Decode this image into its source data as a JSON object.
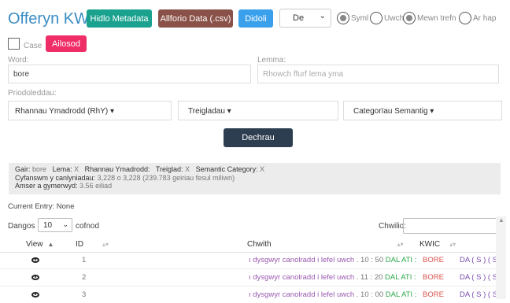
{
  "app": {
    "title": "Offeryn KWIC"
  },
  "toolbar": {
    "metadata_label": "Hidlo Metadata",
    "export_label": "Allforio Data (.csv)",
    "help_label": "Didoli",
    "select_value": "De",
    "radios": [
      {
        "label": "Syml",
        "checked": true
      },
      {
        "label": "Uwch",
        "checked": false
      },
      {
        "label": "Mewn trefn",
        "checked": true
      },
      {
        "label": "Ar hap",
        "checked": false
      }
    ]
  },
  "case_option": {
    "label": "Case",
    "button_label": "Ailosod"
  },
  "search": {
    "word_label": "Word:",
    "word_value": "bore",
    "lemma_label": "Lemma:",
    "lemma_placeholder": "Rhowch ffurf lema yma"
  },
  "attributes": {
    "label": "Priodoleddau:",
    "dropdowns": [
      "Rhannau Ymadrodd (RhY)",
      "Treigladau",
      "Categorïau Semantig"
    ]
  },
  "start_button": "Dechrau",
  "info": {
    "line1_parts": [
      "Gair:",
      "bore",
      "Lema:",
      "X",
      "Rhannau Ymadrodd:",
      "Treiglad:",
      "X",
      "Semantic Category:",
      "X"
    ],
    "totals_label": "Cyfanswm y canlyniadau:",
    "totals_value": "3,228 o 3,228 (239.783 geiriau fesul miliwn)",
    "time_label": "Amser a gymerwyd:",
    "time_value": "3.56 eiliad"
  },
  "current_entry": "Current Entry: None",
  "table_controls": {
    "show_label": "Dangos",
    "show_value": "10",
    "records_label": "cofnod",
    "search_label": "Chwilio:"
  },
  "table": {
    "headers": [
      "View",
      "ID",
      "Chwith",
      "KWIC"
    ],
    "rows": [
      {
        "id": "1",
        "left_a": "ı dysgwyr canolradd i lefel uwch",
        "left_b": ". 10 : 50",
        "left_c": "DAL ATI :",
        "kwic": "BORE",
        "right": "DA ( S ) ( SC"
      },
      {
        "id": "2",
        "left_a": "ı dysgwyr canolradd i lefel uwch",
        "left_b": ". 11 : 20",
        "left_c": "DAL ATI :",
        "kwic": "BORE",
        "right": "DA ( S ) ( SC"
      },
      {
        "id": "3",
        "left_a": "ı dysgwyr canolradd i lefel uwch",
        "left_b": ". 10 : 00",
        "left_c": "DAL ATI :",
        "kwic": "BORE",
        "right": "DA ( S ) ( SC"
      }
    ]
  }
}
